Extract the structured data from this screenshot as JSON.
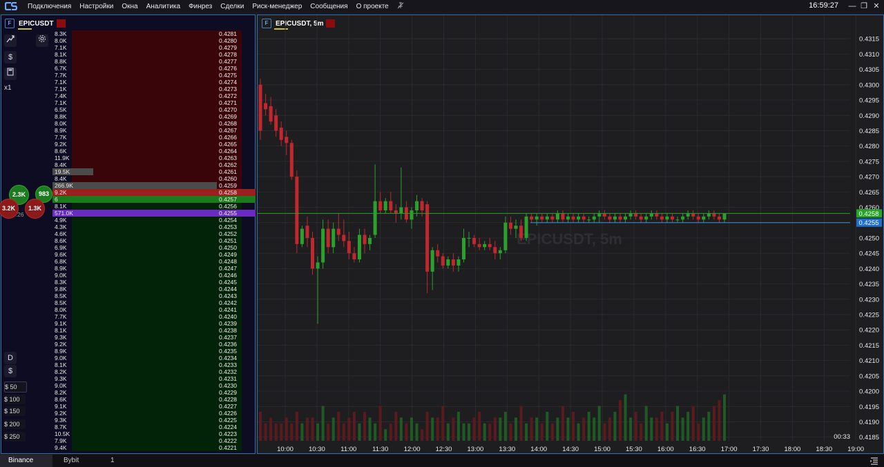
{
  "menubar": {
    "items": [
      "Подключения",
      "Настройки",
      "Окна",
      "Аналитика",
      "Финрез",
      "Сделки",
      "Риск-менеджер",
      "Сообщения",
      "О проекте"
    ],
    "clock": "16:59:27"
  },
  "orderbook": {
    "symbol": "EPICUSDT",
    "symbol_badge": "F",
    "multiplier": "x1",
    "rows": [
      {
        "vol": "8.3K",
        "price": "0.4281",
        "side": "ask"
      },
      {
        "vol": "8.0K",
        "price": "0.4280",
        "side": "ask"
      },
      {
        "vol": "7.1K",
        "price": "0.4279",
        "side": "ask"
      },
      {
        "vol": "8.1K",
        "price": "0.4278",
        "side": "ask"
      },
      {
        "vol": "8.8K",
        "price": "0.4277",
        "side": "ask"
      },
      {
        "vol": "6.7K",
        "price": "0.4276",
        "side": "ask"
      },
      {
        "vol": "7.7K",
        "price": "0.4275",
        "side": "ask"
      },
      {
        "vol": "7.1K",
        "price": "0.4274",
        "side": "ask"
      },
      {
        "vol": "7.1K",
        "price": "0.4273",
        "side": "ask"
      },
      {
        "vol": "7.4K",
        "price": "0.4272",
        "side": "ask"
      },
      {
        "vol": "7.1K",
        "price": "0.4271",
        "side": "ask"
      },
      {
        "vol": "6.5K",
        "price": "0.4270",
        "side": "ask"
      },
      {
        "vol": "8.8K",
        "price": "0.4269",
        "side": "ask"
      },
      {
        "vol": "8.0K",
        "price": "0.4268",
        "side": "ask"
      },
      {
        "vol": "8.9K",
        "price": "0.4267",
        "side": "ask"
      },
      {
        "vol": "7.7K",
        "price": "0.4266",
        "side": "ask"
      },
      {
        "vol": "9.2K",
        "price": "0.4265",
        "side": "ask"
      },
      {
        "vol": "8.6K",
        "price": "0.4264",
        "side": "ask"
      },
      {
        "vol": "11.9K",
        "price": "0.4263",
        "side": "ask"
      },
      {
        "vol": "8.4K",
        "price": "0.4262",
        "side": "ask"
      },
      {
        "vol": "19.5K",
        "price": "0.4261",
        "side": "ask",
        "hl": 0.2
      },
      {
        "vol": "8.4K",
        "price": "0.4260",
        "side": "ask"
      },
      {
        "vol": "266.9K",
        "price": "0.4259",
        "side": "ask",
        "hl": 0.81
      },
      {
        "vol": "9.2K",
        "price": "0.4258",
        "side": "best_ask"
      },
      {
        "vol": "6",
        "price": "0.4257",
        "side": "best_bid"
      },
      {
        "vol": "8.1K",
        "price": "0.4256",
        "side": "bid"
      },
      {
        "vol": "571.0K",
        "price": "0.4255",
        "side": "big_bid"
      },
      {
        "vol": "4.9K",
        "price": "0.4254",
        "side": "bid"
      },
      {
        "vol": "4.3K",
        "price": "0.4253",
        "side": "bid"
      },
      {
        "vol": "4.6K",
        "price": "0.4252",
        "side": "bid"
      },
      {
        "vol": "8.6K",
        "price": "0.4251",
        "side": "bid"
      },
      {
        "vol": "6.9K",
        "price": "0.4250",
        "side": "bid"
      },
      {
        "vol": "9.6K",
        "price": "0.4249",
        "side": "bid"
      },
      {
        "vol": "6.8K",
        "price": "0.4248",
        "side": "bid"
      },
      {
        "vol": "8.9K",
        "price": "0.4247",
        "side": "bid"
      },
      {
        "vol": "9.0K",
        "price": "0.4246",
        "side": "bid"
      },
      {
        "vol": "8.3K",
        "price": "0.4245",
        "side": "bid"
      },
      {
        "vol": "9.8K",
        "price": "0.4244",
        "side": "bid"
      },
      {
        "vol": "8.5K",
        "price": "0.4243",
        "side": "bid"
      },
      {
        "vol": "8.5K",
        "price": "0.4242",
        "side": "bid"
      },
      {
        "vol": "8.0K",
        "price": "0.4241",
        "side": "bid"
      },
      {
        "vol": "7.7K",
        "price": "0.4240",
        "side": "bid"
      },
      {
        "vol": "9.1K",
        "price": "0.4239",
        "side": "bid"
      },
      {
        "vol": "8.1K",
        "price": "0.4238",
        "side": "bid"
      },
      {
        "vol": "9.3K",
        "price": "0.4237",
        "side": "bid"
      },
      {
        "vol": "9.2K",
        "price": "0.4236",
        "side": "bid"
      },
      {
        "vol": "8.9K",
        "price": "0.4235",
        "side": "bid"
      },
      {
        "vol": "9.0K",
        "price": "0.4234",
        "side": "bid"
      },
      {
        "vol": "8.1K",
        "price": "0.4233",
        "side": "bid"
      },
      {
        "vol": "8.2K",
        "price": "0.4232",
        "side": "bid"
      },
      {
        "vol": "9.3K",
        "price": "0.4231",
        "side": "bid"
      },
      {
        "vol": "9.0K",
        "price": "0.4230",
        "side": "bid"
      },
      {
        "vol": "8.2K",
        "price": "0.4229",
        "side": "bid"
      },
      {
        "vol": "8.6K",
        "price": "0.4228",
        "side": "bid"
      },
      {
        "vol": "9.1K",
        "price": "0.4227",
        "side": "bid"
      },
      {
        "vol": "9.2K",
        "price": "0.4226",
        "side": "bid"
      },
      {
        "vol": "9.3K",
        "price": "0.4225",
        "side": "bid"
      },
      {
        "vol": "8.7K",
        "price": "0.4224",
        "side": "bid"
      },
      {
        "vol": "10.5K",
        "price": "0.4223",
        "side": "bid"
      },
      {
        "vol": "7.9K",
        "price": "0.4222",
        "side": "bid"
      },
      {
        "vol": "9.4K",
        "price": "0.4221",
        "side": "bid"
      }
    ],
    "bubbles": [
      {
        "label": "2.3K",
        "color": "#1e7a1e"
      },
      {
        "label": "983",
        "color": "#1e7a1e"
      },
      {
        "label": "3.2K",
        "color": "#8c1a1a"
      },
      {
        "label": "1.3K",
        "color": "#8c1a1a"
      }
    ],
    "partial_price": "3.26",
    "bottom_tools": {
      "d_label": "D",
      "dollar": "$"
    },
    "quantities": [
      "$ 50",
      "$ 100",
      "$ 150",
      "$ 200",
      "$ 250"
    ]
  },
  "chart_data": {
    "type": "candlestick",
    "title": "EPICUSDT, 5m",
    "watermark": "EPICUSDT, 5m",
    "price_ticks": [
      "0.4315",
      "0.4310",
      "0.4305",
      "0.4300",
      "0.4295",
      "0.4290",
      "0.4285",
      "0.4280",
      "0.4275",
      "0.4270",
      "0.4265",
      "0.4260",
      "0.4255",
      "0.4250",
      "0.4245",
      "0.4240",
      "0.4235",
      "0.4230",
      "0.4225",
      "0.4220",
      "0.4215",
      "0.4210",
      "0.4205",
      "0.4200",
      "0.4195",
      "0.4190",
      "0.4185"
    ],
    "time_ticks": [
      "10:00",
      "10:30",
      "11:00",
      "11:30",
      "12:00",
      "12:30",
      "13:00",
      "13:30",
      "14:00",
      "14:30",
      "15:00",
      "15:30",
      "16:00",
      "16:30",
      "17:00",
      "17:30",
      "18:00",
      "18:30",
      "19:00"
    ],
    "current_price": "0.4258",
    "level_price": "0.4255",
    "countdown": "00:33",
    "y_range": [
      0.41838,
      0.43182
    ],
    "candles": [
      [
        0.43,
        0.4302,
        0.4282,
        0.4285
      ],
      [
        0.4294,
        0.4297,
        0.429,
        0.4292
      ],
      [
        0.4293,
        0.4296,
        0.4287,
        0.4288
      ],
      [
        0.429,
        0.4292,
        0.4283,
        0.4285
      ],
      [
        0.4286,
        0.4288,
        0.428,
        0.4282
      ],
      [
        0.4283,
        0.4285,
        0.4277,
        0.4281
      ],
      [
        0.4281,
        0.4282,
        0.4269,
        0.427
      ],
      [
        0.427,
        0.4272,
        0.4245,
        0.4248
      ],
      [
        0.4248,
        0.4254,
        0.4247,
        0.4253
      ],
      [
        0.4254,
        0.4257,
        0.4247,
        0.425
      ],
      [
        0.425,
        0.4252,
        0.4238,
        0.424
      ],
      [
        0.424,
        0.4244,
        0.4222,
        0.4242
      ],
      [
        0.4242,
        0.4256,
        0.424,
        0.4253
      ],
      [
        0.4253,
        0.4256,
        0.4245,
        0.4247
      ],
      [
        0.4247,
        0.4255,
        0.4245,
        0.4253
      ],
      [
        0.4253,
        0.4258,
        0.4249,
        0.4251
      ],
      [
        0.4251,
        0.4256,
        0.4247,
        0.4249
      ],
      [
        0.4249,
        0.4252,
        0.4243,
        0.4245
      ],
      [
        0.4245,
        0.4247,
        0.4242,
        0.4243
      ],
      [
        0.4243,
        0.4253,
        0.4242,
        0.4251
      ],
      [
        0.4251,
        0.4253,
        0.4245,
        0.4248
      ],
      [
        0.4248,
        0.4251,
        0.4246,
        0.425
      ],
      [
        0.4251,
        0.4274,
        0.425,
        0.4262
      ],
      [
        0.4262,
        0.4265,
        0.4258,
        0.4259
      ],
      [
        0.4259,
        0.4263,
        0.4258,
        0.4262
      ],
      [
        0.4262,
        0.4265,
        0.4258,
        0.4259
      ],
      [
        0.4259,
        0.4261,
        0.4255,
        0.4258
      ],
      [
        0.4258,
        0.4273,
        0.4256,
        0.426
      ],
      [
        0.426,
        0.4262,
        0.4255,
        0.4256
      ],
      [
        0.4256,
        0.426,
        0.4253,
        0.4259
      ],
      [
        0.4259,
        0.4264,
        0.4257,
        0.4262
      ],
      [
        0.4262,
        0.4263,
        0.4257,
        0.4259
      ],
      [
        0.4261,
        0.4262,
        0.4232,
        0.4239
      ],
      [
        0.4239,
        0.4247,
        0.4233,
        0.4246
      ],
      [
        0.4246,
        0.4248,
        0.4242,
        0.4244
      ],
      [
        0.4244,
        0.4245,
        0.424,
        0.4241
      ],
      [
        0.4241,
        0.4244,
        0.424,
        0.4243
      ],
      [
        0.4243,
        0.4245,
        0.4239,
        0.4241
      ],
      [
        0.4241,
        0.4244,
        0.4239,
        0.4243
      ],
      [
        0.4243,
        0.4253,
        0.4242,
        0.425
      ],
      [
        0.425,
        0.4252,
        0.4247,
        0.425
      ],
      [
        0.425,
        0.4251,
        0.4247,
        0.4248
      ],
      [
        0.4248,
        0.425,
        0.4246,
        0.4247
      ],
      [
        0.4247,
        0.4249,
        0.4246,
        0.4248
      ],
      [
        0.4248,
        0.425,
        0.4246,
        0.4247
      ],
      [
        0.4247,
        0.4249,
        0.4243,
        0.4245
      ],
      [
        0.4245,
        0.4247,
        0.4243,
        0.4246
      ],
      [
        0.4246,
        0.4257,
        0.4245,
        0.4255
      ],
      [
        0.4255,
        0.4257,
        0.4251,
        0.4253
      ],
      [
        0.4253,
        0.4256,
        0.425,
        0.4254
      ],
      [
        0.4254,
        0.4256,
        0.4249,
        0.425
      ],
      [
        0.425,
        0.4258,
        0.4249,
        0.4257
      ],
      [
        0.4257,
        0.4258,
        0.4255,
        0.4256
      ],
      [
        0.4256,
        0.4258,
        0.4254,
        0.4257
      ],
      [
        0.4257,
        0.4258,
        0.4255,
        0.4256
      ],
      [
        0.4256,
        0.4258,
        0.4255,
        0.4257
      ],
      [
        0.4257,
        0.4258,
        0.4255,
        0.4256
      ],
      [
        0.4256,
        0.4259,
        0.4255,
        0.4258
      ],
      [
        0.4258,
        0.4259,
        0.4255,
        0.4256
      ],
      [
        0.4256,
        0.4258,
        0.4255,
        0.4257
      ],
      [
        0.4257,
        0.4258,
        0.4255,
        0.4256
      ],
      [
        0.4256,
        0.4258,
        0.4255,
        0.4257
      ],
      [
        0.4257,
        0.4258,
        0.4255,
        0.4256
      ],
      [
        0.4256,
        0.4257,
        0.4255,
        0.4256
      ],
      [
        0.4256,
        0.4258,
        0.4255,
        0.4257
      ],
      [
        0.4257,
        0.4259,
        0.4255,
        0.4258
      ],
      [
        0.4258,
        0.4259,
        0.4256,
        0.4257
      ],
      [
        0.4257,
        0.4258,
        0.4255,
        0.4256
      ],
      [
        0.4256,
        0.4258,
        0.4255,
        0.4257
      ],
      [
        0.4257,
        0.4258,
        0.4255,
        0.4256
      ],
      [
        0.4256,
        0.4258,
        0.4255,
        0.4257
      ],
      [
        0.4257,
        0.4259,
        0.4256,
        0.4258
      ],
      [
        0.4258,
        0.4259,
        0.4256,
        0.4257
      ],
      [
        0.4257,
        0.4258,
        0.4255,
        0.4256
      ],
      [
        0.4256,
        0.4258,
        0.4255,
        0.4257
      ],
      [
        0.4257,
        0.4259,
        0.4256,
        0.4258
      ],
      [
        0.4258,
        0.4259,
        0.4256,
        0.4257
      ],
      [
        0.4257,
        0.4258,
        0.4255,
        0.4256
      ],
      [
        0.4256,
        0.4258,
        0.4255,
        0.4257
      ],
      [
        0.4257,
        0.4258,
        0.4255,
        0.4256
      ],
      [
        0.4256,
        0.4257,
        0.4255,
        0.4256
      ],
      [
        0.4256,
        0.4258,
        0.4255,
        0.4257
      ],
      [
        0.4257,
        0.4259,
        0.4256,
        0.4258
      ],
      [
        0.4258,
        0.4259,
        0.4256,
        0.4257
      ],
      [
        0.4257,
        0.4258,
        0.4255,
        0.4256
      ],
      [
        0.4256,
        0.4258,
        0.4255,
        0.4257
      ],
      [
        0.4257,
        0.4259,
        0.4256,
        0.4258
      ],
      [
        0.4258,
        0.4259,
        0.4256,
        0.4257
      ],
      [
        0.4257,
        0.4258,
        0.4255,
        0.4256
      ],
      [
        0.4256,
        0.4258,
        0.4255,
        0.4258
      ]
    ],
    "volumes": [
      5,
      3,
      4,
      3,
      3,
      4,
      3,
      5,
      3,
      4,
      4,
      3,
      6,
      3,
      4,
      5,
      3,
      4,
      5,
      3,
      5,
      4,
      3,
      6,
      2,
      3,
      5,
      4,
      3,
      4,
      3,
      2,
      5,
      4,
      4,
      6,
      3,
      4,
      5,
      3,
      3,
      4,
      5,
      3,
      3,
      4,
      4,
      5,
      3,
      4,
      6,
      3,
      4,
      4,
      3,
      5,
      3,
      4,
      6,
      4,
      5,
      3,
      4,
      5,
      4,
      6,
      3,
      4,
      5,
      7,
      8,
      4,
      5,
      3,
      6,
      4,
      4,
      5,
      3,
      5,
      6,
      4,
      5,
      6,
      3,
      4,
      5,
      6,
      7,
      8,
      12,
      9,
      14,
      22,
      17,
      19
    ]
  },
  "statusbar": {
    "tabs": [
      "Binance",
      "Bybit",
      "1"
    ]
  }
}
